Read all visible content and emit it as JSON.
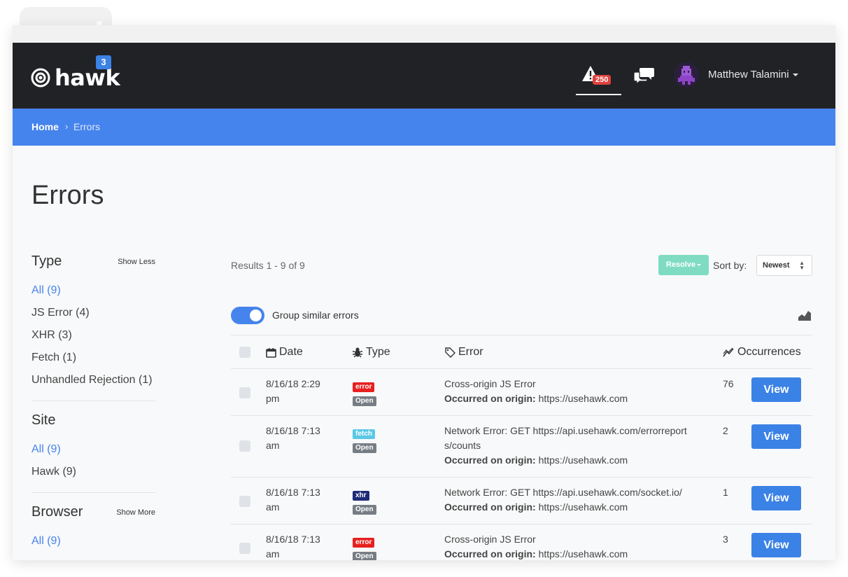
{
  "app": {
    "logo_text": "hawk",
    "logo_badge": "3"
  },
  "nav": {
    "alerts_count": "250",
    "user_name": "Matthew Talamini"
  },
  "breadcrumb": {
    "home": "Home",
    "separator": "›",
    "current": "Errors"
  },
  "page": {
    "title": "Errors"
  },
  "filters": {
    "type": {
      "heading": "Type",
      "toggle": "Show Less",
      "items": [
        "All (9)",
        "JS Error (4)",
        "XHR (3)",
        "Fetch (1)",
        "Unhandled Rejection (1)"
      ]
    },
    "site": {
      "heading": "Site",
      "items": [
        "All (9)",
        "Hawk (9)"
      ]
    },
    "browser": {
      "heading": "Browser",
      "toggle": "Show More",
      "items": [
        "All (9)"
      ]
    }
  },
  "toolbar": {
    "results": "Results 1 - 9 of 9",
    "resolve": "Resolve",
    "sort_label": "Sort by:",
    "sort_value": "Newest",
    "group_label": "Group similar errors",
    "group_enabled": true
  },
  "table": {
    "columns": {
      "date": "Date",
      "type": "Type",
      "error": "Error",
      "occurrences": "Occurrences"
    },
    "origin_label": "Occurred on origin:",
    "view_label": "View",
    "rows": [
      {
        "date_line1": "8/16/18 2:29",
        "date_line2": "pm",
        "type_tag": "error",
        "status_tag": "Open",
        "message_line1": "Cross-origin JS Error",
        "message_line2": "",
        "origin": "https://usehawk.com",
        "occurrences": "76"
      },
      {
        "date_line1": "8/16/18 7:13",
        "date_line2": "am",
        "type_tag": "fetch",
        "status_tag": "Open",
        "message_line1": "Network Error: GET https://api.usehawk.com/errorreport",
        "message_line2": "s/counts",
        "origin": "https://usehawk.com",
        "occurrences": "2"
      },
      {
        "date_line1": "8/16/18 7:13",
        "date_line2": "am",
        "type_tag": "xhr",
        "status_tag": "Open",
        "message_line1": "Network Error: GET https://api.usehawk.com/socket.io/",
        "message_line2": "",
        "origin": "https://usehawk.com",
        "occurrences": "1"
      },
      {
        "date_line1": "8/16/18 7:13",
        "date_line2": "am",
        "type_tag": "error",
        "status_tag": "Open",
        "message_line1": "Cross-origin JS Error",
        "message_line2": "",
        "origin": "https://usehawk.com",
        "occurrences": "3"
      }
    ]
  },
  "colors": {
    "navbar": "#202226",
    "breadcrumb": "#4684ed",
    "primary": "#3b82e6",
    "resolve": "#7fdcc3",
    "tag_error": "#e7201f",
    "tag_fetch": "#5bc8e6",
    "tag_xhr": "#1e2a78",
    "tag_open": "#777d84"
  }
}
